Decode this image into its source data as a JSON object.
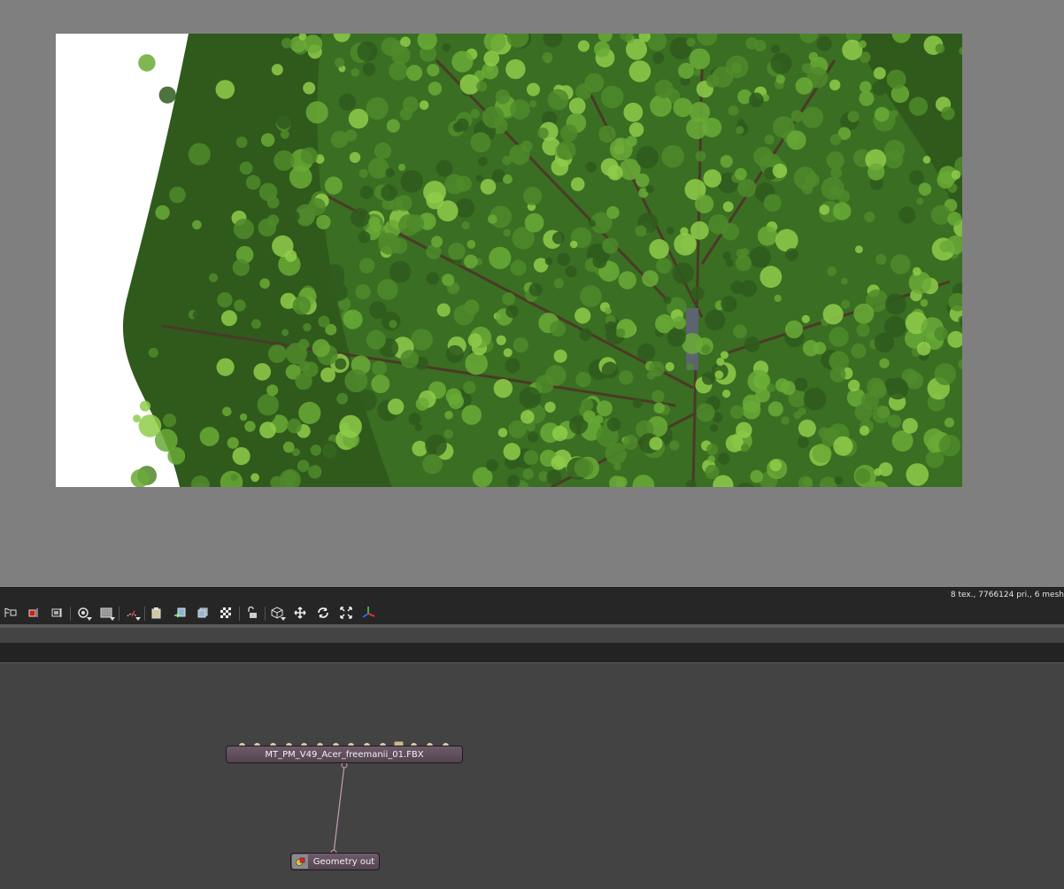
{
  "viewport": {
    "render_description_colors": {
      "sky": "#ffffff",
      "leaf_dark": "#2f5a1c",
      "leaf_mid": "#4f8a2a",
      "leaf_light": "#8fcc4a",
      "branch": "#4a3a28"
    }
  },
  "toolbar": {
    "stats": "8 tex., 7766124 pri., 6 mesh",
    "buttons": [
      "select-icon",
      "red-select-icon",
      "frame-icon",
      "camera-dropdown-icon",
      "grid-dropdown-icon",
      "render-dropdown-icon",
      "clipboard-icon",
      "import-icon",
      "layers-icon",
      "checker-icon",
      "unlock-icon",
      "cube-dropdown-icon",
      "move-icon",
      "rotate-icon",
      "scale-icon",
      "axis-gizmo-icon"
    ]
  },
  "graph": {
    "nodes": [
      {
        "title": "MT_PM_V49_Acer_freemanii_01.FBX",
        "input_pin_count": 14,
        "active_pin_index": 10
      },
      {
        "title": "Geometry out"
      }
    ],
    "wire_color": "#c89ab8"
  }
}
